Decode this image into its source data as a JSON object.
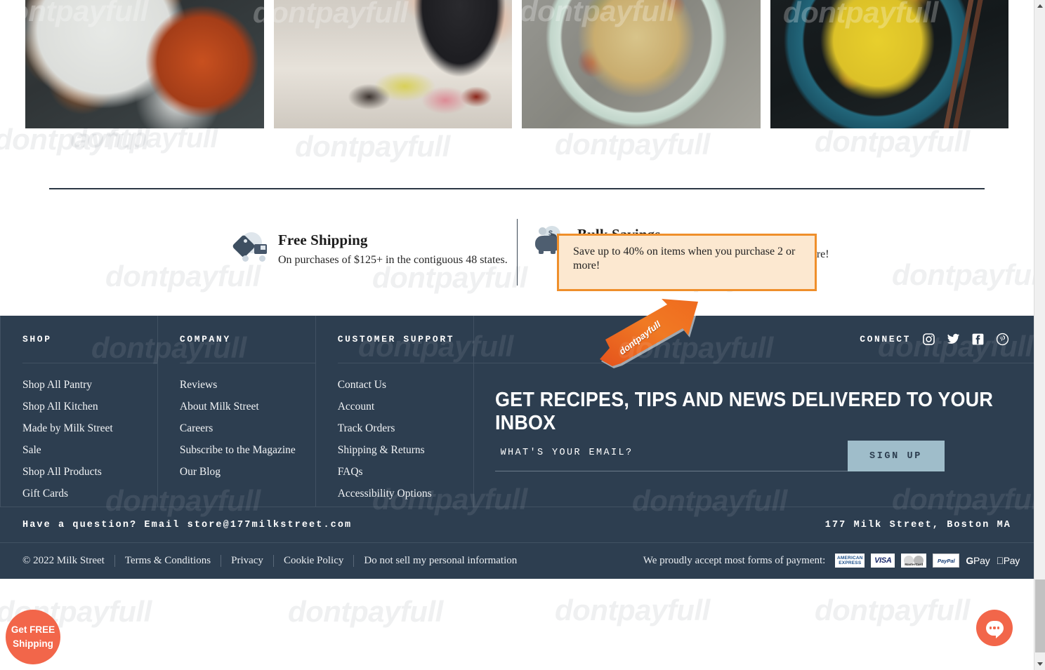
{
  "gallery": {
    "items": [
      {
        "alt": "Grilled shrimp on a white plate beside a pot of shrimp"
      },
      {
        "alt": "Person eating at a sushi counter holding chopsticks"
      },
      {
        "alt": "Chickpea and spinach stew in a pale green bowl with breadcrumbs"
      },
      {
        "alt": "Yellow turmeric noodles with squash in a teal dish with chopsticks"
      }
    ]
  },
  "benefits": [
    {
      "icon": "delivery-truck-icon",
      "title": "Free Shipping",
      "description": "On purchases of $125+ in the contiguous 48 states."
    },
    {
      "icon": "piggy-bank-icon",
      "title": "Bulk Savings",
      "description": "Save up to 40% on items when you purchase 2 or more!"
    }
  ],
  "highlight_tooltip": {
    "text": "Save up to 40% on items when you purchase 2 or more!",
    "border_color": "#ef8f2b",
    "background_color": "#fce8d0"
  },
  "footer": {
    "background_color": "#2d3e50",
    "columns": [
      {
        "heading": "SHOP",
        "links": [
          "Shop All Pantry",
          "Shop All Kitchen",
          "Made by Milk Street",
          "Sale",
          "Shop All Products",
          "Gift Cards"
        ]
      },
      {
        "heading": "COMPANY",
        "links": [
          "Reviews",
          "About Milk Street",
          "Careers",
          "Subscribe to the Magazine",
          "Our Blog"
        ]
      },
      {
        "heading": "CUSTOMER SUPPORT",
        "links": [
          "Contact Us",
          "Account",
          "Track Orders",
          "Shipping & Returns",
          "FAQs",
          "Accessibility Options"
        ]
      }
    ],
    "connect": {
      "label": "CONNECT",
      "socials": [
        "instagram-icon",
        "twitter-icon",
        "facebook-icon",
        "pinterest-icon"
      ]
    },
    "newsletter": {
      "title": "GET RECIPES, TIPS AND NEWS DELIVERED TO YOUR INBOX",
      "placeholder": "WHAT'S YOUR EMAIL?",
      "value": "",
      "button_label": "SIGN UP",
      "button_color": "#9fbdca"
    },
    "contact_bar": {
      "question": "Have a question? Email store@177milkstreet.com",
      "address": "177 Milk Street, Boston MA"
    },
    "legal": {
      "copyright": "© 2022 Milk Street",
      "links": [
        "Terms & Conditions",
        "Privacy",
        "Cookie Policy",
        "Do not sell my personal information"
      ]
    },
    "payments": {
      "label": "We proudly accept most forms of payment:",
      "methods": [
        {
          "name": "american-express",
          "line1": "AMERICAN",
          "line2": "EXPRESS"
        },
        {
          "name": "visa",
          "label": "VISA"
        },
        {
          "name": "mastercard",
          "label": "MasterCard"
        },
        {
          "name": "paypal",
          "label": "PayPal"
        },
        {
          "name": "google-pay",
          "prefix": "G",
          "label": " Pay"
        },
        {
          "name": "apple-pay",
          "prefix": "",
          "label": "Pay"
        }
      ]
    }
  },
  "overlays": {
    "arrow_label": "dontpayfull",
    "arrow_color": "#ec6b1e",
    "watermark_text": "dontpayfull"
  },
  "floating": {
    "free_shipping_badge": {
      "line1": "Get FREE",
      "line2": "Shipping",
      "color": "#f2664a"
    },
    "chat_button": {
      "icon": "chat-bubble-icon",
      "color": "#f2664a"
    }
  }
}
